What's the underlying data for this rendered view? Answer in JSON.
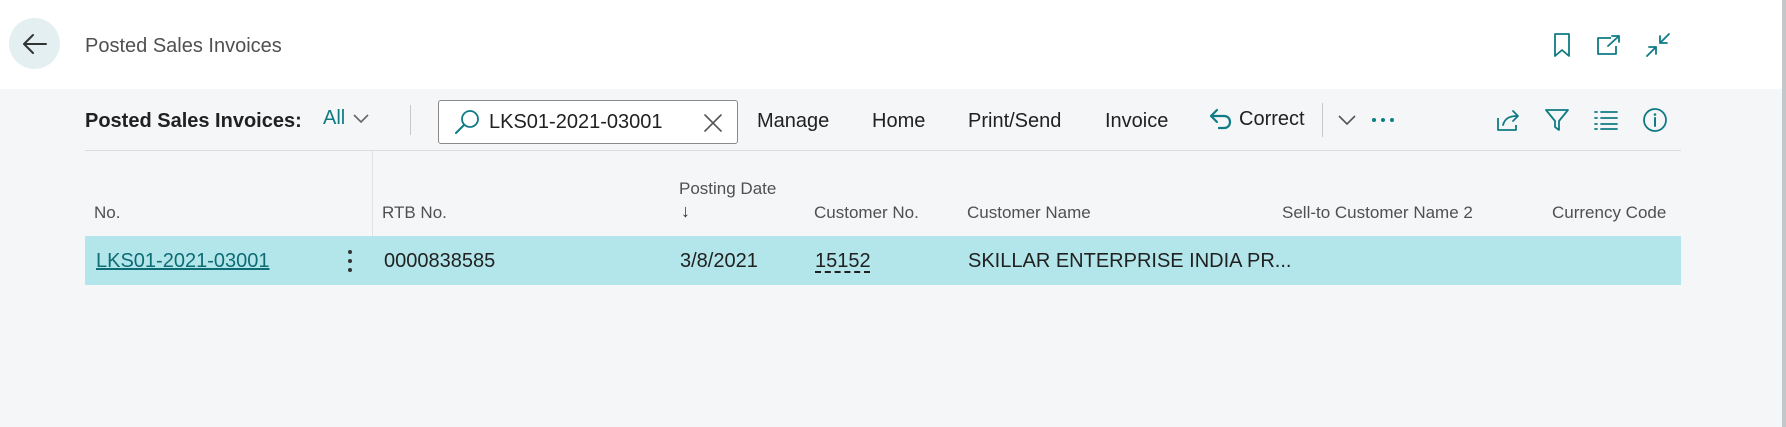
{
  "window": {
    "title": "Posted Sales Invoices"
  },
  "action_bar": {
    "title": "Posted Sales Invoices:",
    "view": "All",
    "search_value": "LKS01-2021-03001",
    "menu": {
      "manage": "Manage",
      "home": "Home",
      "print_send": "Print/Send",
      "invoice": "Invoice",
      "correct": "Correct"
    }
  },
  "table": {
    "columns": {
      "no": "No.",
      "rtb_no": "RTB No.",
      "posting_date": "Posting Date",
      "sort_arrow": "↓",
      "customer_no": "Customer No.",
      "customer_name": "Customer Name",
      "sell_to_name_2": "Sell-to Customer Name 2",
      "currency_code": "Currency Code"
    },
    "rows": [
      {
        "no": "LKS01-2021-03001",
        "rtb_no": "0000838585",
        "posting_date": "3/8/2021",
        "customer_no": "15152",
        "customer_name": "SKILLAR ENTERPRISE INDIA PR...",
        "sell_to_name_2": "",
        "currency_code": ""
      }
    ]
  },
  "colors": {
    "accent": "#0f7b84",
    "row_selected": "#b3e6ea",
    "back_button": "#e3eff1"
  },
  "icons": {
    "back": "arrow-left-icon",
    "bookmark": "bookmark-icon",
    "open_new": "open-in-new-window-icon",
    "collapse": "collapse-icon",
    "search": "search-icon",
    "clear": "close-icon",
    "correct": "undo-icon",
    "share": "share-icon",
    "filter": "filter-icon",
    "list": "list-icon",
    "info": "info-icon"
  }
}
